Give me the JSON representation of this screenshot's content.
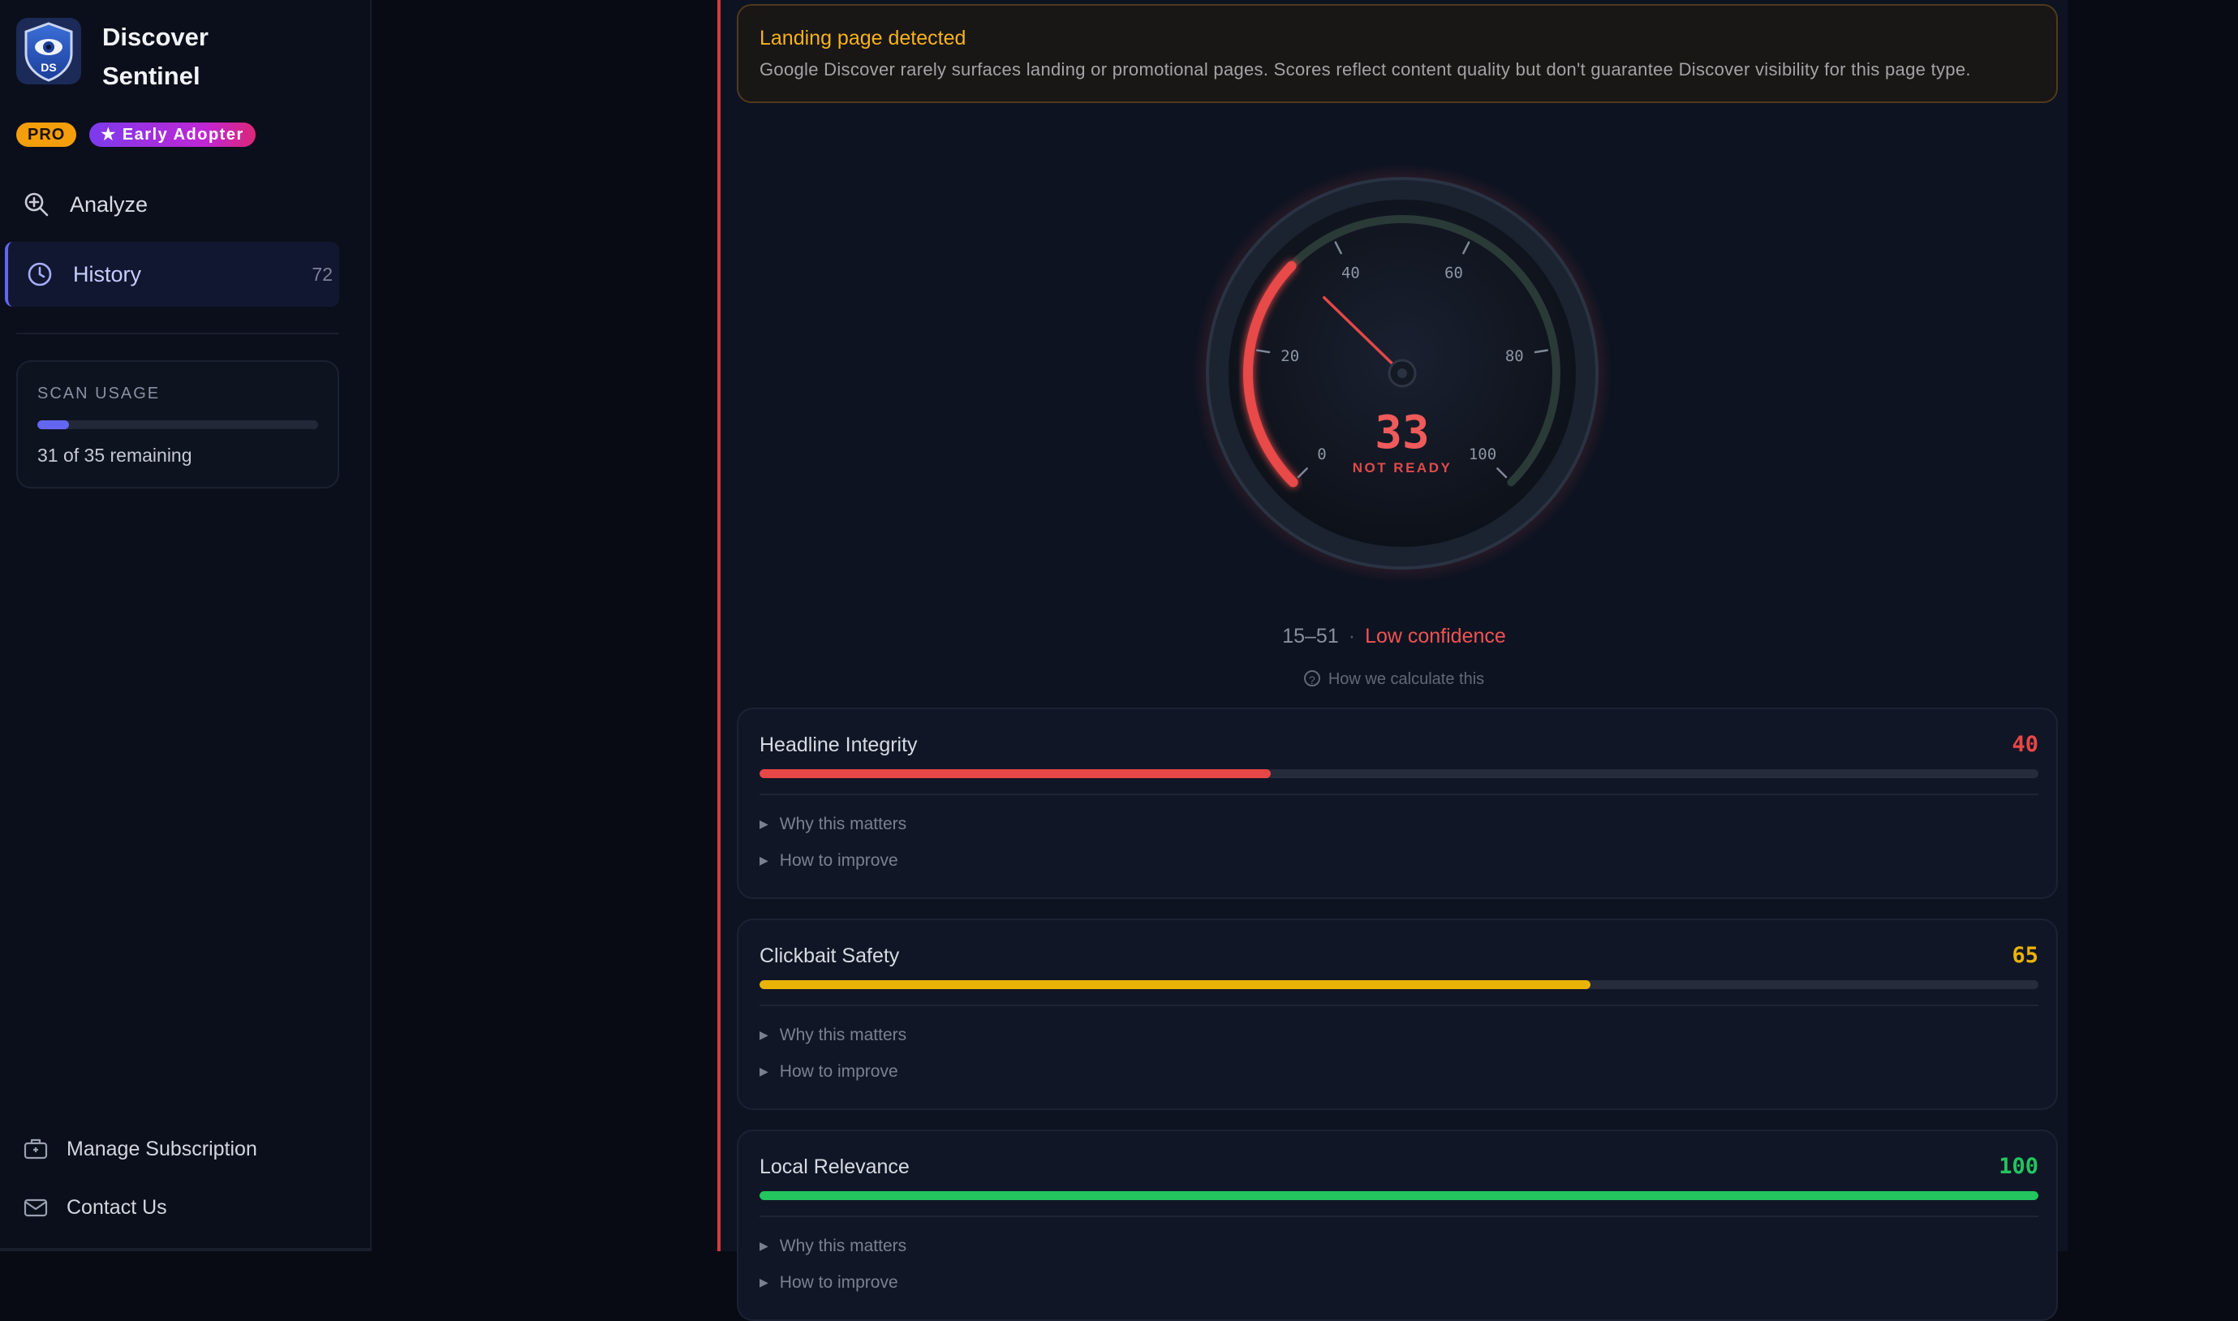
{
  "app": {
    "name": "Discover Sentinel",
    "logo_initials": "DS",
    "badges": {
      "pro": "PRO",
      "early_adopter": "★ Early Adopter"
    }
  },
  "sidebar": {
    "nav": [
      {
        "label": "Analyze",
        "icon": "zoom-in-icon"
      },
      {
        "label": "History",
        "icon": "clock-icon",
        "count": "72"
      }
    ],
    "scan_usage": {
      "title": "SCAN USAGE",
      "remaining_text": "31 of 35 remaining",
      "used_fraction": 0.114
    },
    "footer_links": [
      {
        "label": "Manage Subscription",
        "icon": "subscription-icon"
      },
      {
        "label": "Contact Us",
        "icon": "mail-icon"
      }
    ]
  },
  "alert": {
    "title": "Landing page detected",
    "body": "Google Discover rarely surfaces landing or promotional pages. Scores reflect content quality but don't guarantee Discover visibility for this page type."
  },
  "gauge": {
    "score": "33",
    "status": "NOT READY",
    "value": 33,
    "ticks": [
      "0",
      "20",
      "40",
      "60",
      "80",
      "100"
    ],
    "range": "15–51",
    "confidence": "Low confidence",
    "how_link": "How we calculate this",
    "colors": {
      "danger": "#e84a4a"
    }
  },
  "metrics": [
    {
      "name": "Headline Integrity",
      "score": "40",
      "value": 40,
      "color": "#e84747",
      "why": "Why this matters",
      "how": "How to improve"
    },
    {
      "name": "Clickbait Safety",
      "score": "65",
      "value": 65,
      "color": "#eab308",
      "why": "Why this matters",
      "how": "How to improve"
    },
    {
      "name": "Local Relevance",
      "score": "100",
      "value": 100,
      "color": "#22c55e",
      "why": "Why this matters",
      "how": "How to improve"
    }
  ]
}
